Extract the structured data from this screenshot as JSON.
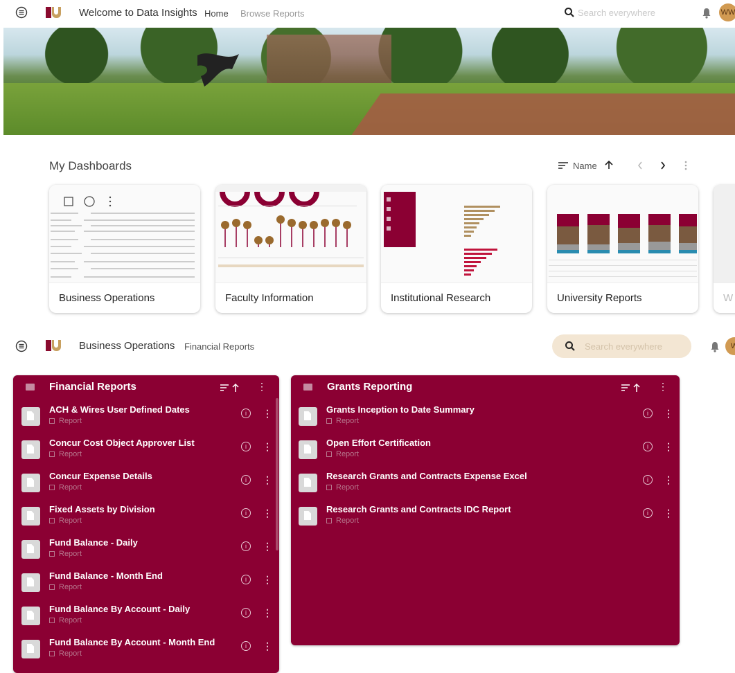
{
  "header": {
    "title": "Welcome to Data Insights",
    "nav": [
      "Home",
      "Browse Reports"
    ],
    "search_placeholder": "Search everywhere",
    "avatar_initials": "WW"
  },
  "dashboards": {
    "title": "My Dashboards",
    "sort_label": "Name",
    "cards": [
      {
        "label": "Business Operations"
      },
      {
        "label": "Faculty Information"
      },
      {
        "label": "Institutional Research"
      },
      {
        "label": "University Reports"
      },
      {
        "label": "W"
      }
    ]
  },
  "subheader": {
    "breadcrumb_current": "Business Operations",
    "breadcrumb_child": "Financial Reports",
    "search_placeholder": "Search everywhere",
    "avatar_initial": "W"
  },
  "panels": [
    {
      "title": "Financial Reports",
      "items": [
        {
          "title": "ACH & Wires User Defined Dates",
          "type": "Report"
        },
        {
          "title": "Concur Cost Object Approver List",
          "type": "Report"
        },
        {
          "title": "Concur Expense Details",
          "type": "Report"
        },
        {
          "title": "Fixed Assets by Division",
          "type": "Report"
        },
        {
          "title": "Fund Balance - Daily",
          "type": "Report"
        },
        {
          "title": "Fund Balance - Month End",
          "type": "Report"
        },
        {
          "title": "Fund Balance By Account - Daily",
          "type": "Report"
        },
        {
          "title": "Fund Balance By Account - Month End",
          "type": "Report"
        }
      ]
    },
    {
      "title": "Grants Reporting",
      "items": [
        {
          "title": "Grants Inception to Date Summary",
          "type": "Report"
        },
        {
          "title": "Open Effort Certification",
          "type": "Report"
        },
        {
          "title": "Research Grants and Contracts Expense Excel",
          "type": "Report"
        },
        {
          "title": "Research Grants and Contracts IDC Report",
          "type": "Report"
        }
      ]
    }
  ],
  "colors": {
    "brand": "#8b0033",
    "accent": "#c8a060",
    "search_bg": "#f3e6d3"
  }
}
